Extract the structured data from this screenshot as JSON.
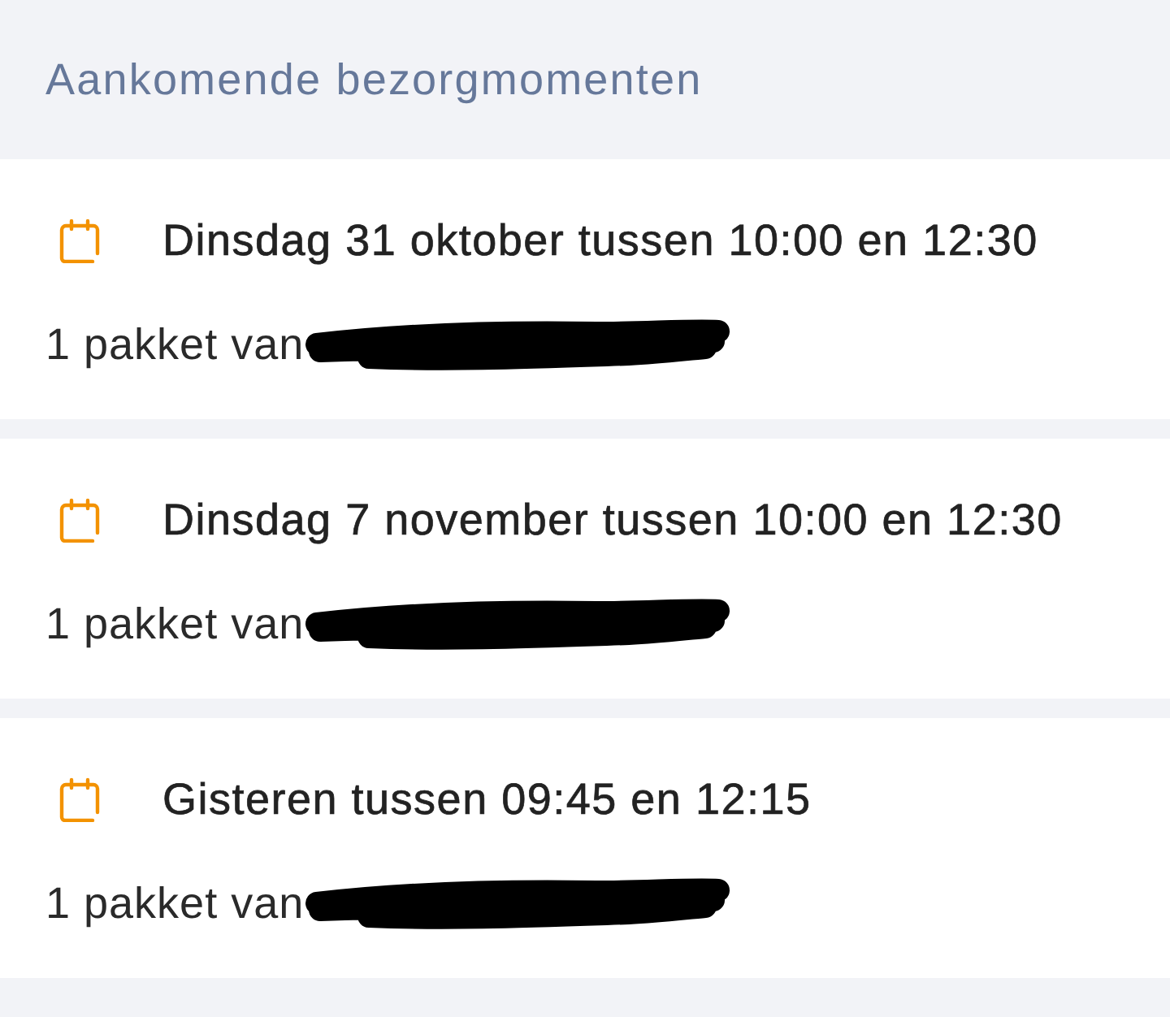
{
  "header": {
    "title": "Aankomende bezorgmomenten"
  },
  "deliveries": [
    {
      "moment": "Dinsdag 31 oktober tussen 10:00 en 12:30",
      "parcels": "1 pakket van",
      "redacted": true
    },
    {
      "moment": "Dinsdag 7 november tussen 10:00 en 12:30",
      "parcels": "1 pakket van",
      "redacted": true
    },
    {
      "moment": "Gisteren tussen 09:45 en 12:15",
      "parcels": "1 pakket van",
      "redacted": true
    }
  ]
}
